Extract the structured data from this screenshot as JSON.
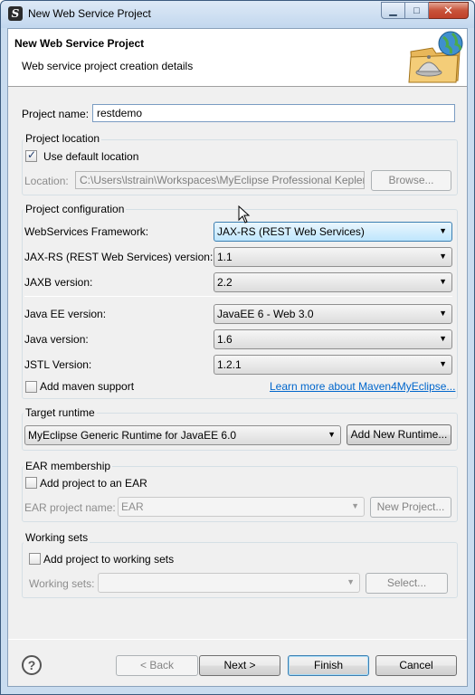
{
  "window": {
    "title": "New Web Service Project",
    "app_icon": "myeclipse-icon",
    "controls": {
      "minimize": "minimize-icon",
      "maximize": "maximize-icon",
      "close": "close-icon"
    }
  },
  "banner": {
    "title": "New Web Service Project",
    "subtitle": "Web service project creation details",
    "image": "web-service-globe-icon"
  },
  "project_name": {
    "label": "Project name:",
    "value": "restdemo"
  },
  "project_location": {
    "title": "Project location",
    "use_default_label": "Use default location",
    "use_default_checked": true,
    "location_label": "Location:",
    "location_value": "C:\\Users\\lstrain\\Workspaces\\MyEclipse Professional Kepler\\",
    "browse_label": "Browse..."
  },
  "project_configuration": {
    "title": "Project configuration",
    "framework_label": "WebServices Framework:",
    "framework_value": "JAX-RS (REST Web Services)",
    "jaxrs_version_label": "JAX-RS (REST Web Services) version:",
    "jaxrs_version_value": "1.1",
    "jaxb_label": "JAXB version:",
    "jaxb_value": "2.2",
    "javaee_label": "Java EE version:",
    "javaee_value": "JavaEE 6 - Web 3.0",
    "java_label": "Java version:",
    "java_value": "1.6",
    "jstl_label": "JSTL Version:",
    "jstl_value": "1.2.1",
    "maven_label": "Add maven support",
    "maven_checked": false,
    "maven_link": "Learn more about Maven4MyEclipse..."
  },
  "target_runtime": {
    "title": "Target runtime",
    "value": "MyEclipse Generic Runtime for JavaEE 6.0",
    "add_button": "Add New Runtime..."
  },
  "ear_membership": {
    "title": "EAR membership",
    "add_label": "Add project to an EAR",
    "add_checked": false,
    "name_label": "EAR project name:",
    "name_value": "EAR",
    "new_project_button": "New Project..."
  },
  "working_sets": {
    "title": "Working sets",
    "add_label": "Add project to working sets",
    "add_checked": false,
    "sets_label": "Working sets:",
    "sets_value": "",
    "select_button": "Select..."
  },
  "footer": {
    "help_icon": "help-icon",
    "help_glyph": "?",
    "back": "< Back",
    "next": "Next >",
    "finish": "Finish",
    "cancel": "Cancel"
  }
}
